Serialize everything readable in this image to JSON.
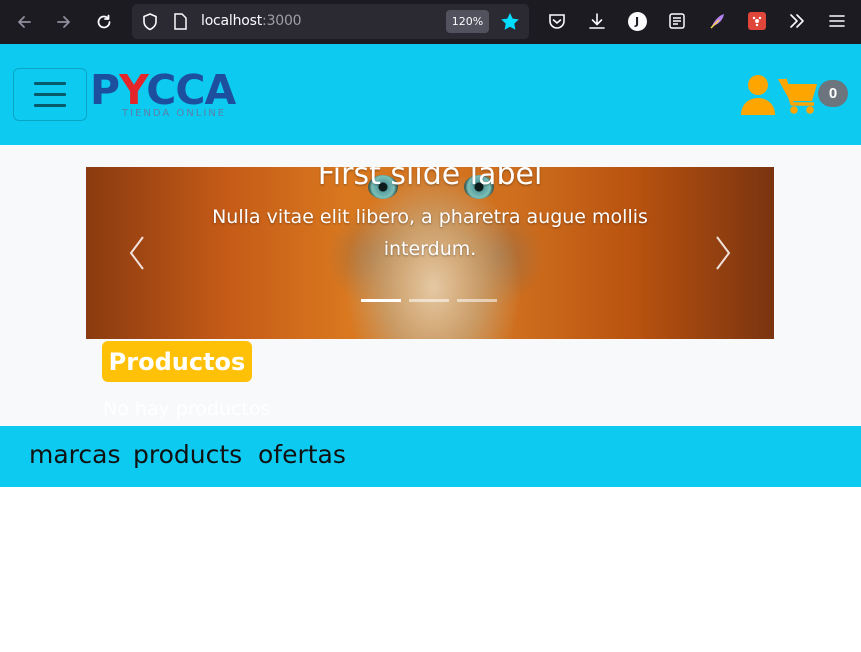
{
  "browser": {
    "url_host": "localhost",
    "url_port": ":3000",
    "zoom": "120%"
  },
  "header": {
    "logo_text_left": "P",
    "logo_text_y": "Y",
    "logo_text_right": "CCA",
    "logo_tagline": "TIENDA ONLINE",
    "cart_count": "0",
    "colors": {
      "bar": "#0dcaf0",
      "accent": "#ffa500"
    }
  },
  "carousel": {
    "title": "First slide label",
    "text": "Nulla vitae elit libero, a pharetra augue mollis interdum.",
    "slides": 3,
    "active_slide": 1
  },
  "main": {
    "section_label": "Productos",
    "empty_message": "No hay productos"
  },
  "bottom_nav": {
    "items": [
      {
        "label": "marcas"
      },
      {
        "label": "products"
      },
      {
        "label": "ofertas"
      }
    ]
  }
}
